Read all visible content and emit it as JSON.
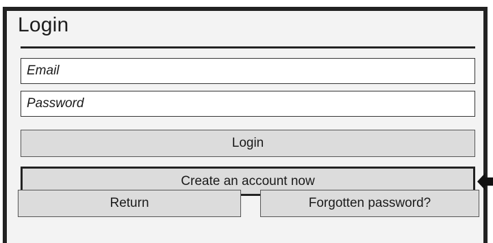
{
  "form": {
    "title": "Login",
    "email_placeholder": "Email",
    "password_placeholder": "Password"
  },
  "buttons": {
    "login": "Login",
    "create_account": "Create an account now",
    "return": "Return",
    "forgot_password": "Forgotten password?"
  },
  "icons": {
    "pointer": "left-arrow-icon"
  }
}
